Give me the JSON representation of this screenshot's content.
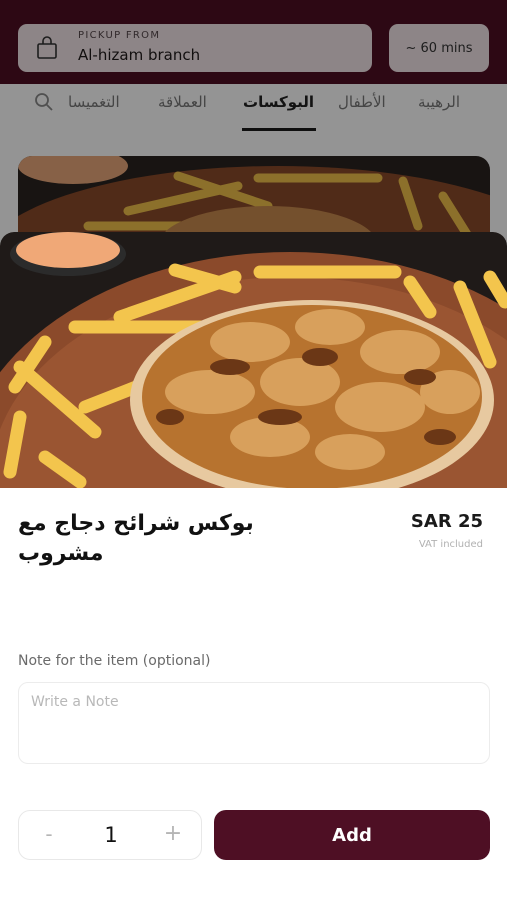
{
  "header": {
    "pickup_label": "PICKUP FROM",
    "branch_name": "Al-hizam branch",
    "eta": "~ 60 mins",
    "icons": {
      "pickup": "shopping-bag-icon"
    }
  },
  "categories": {
    "tabs": [
      {
        "label": "الرهيبة",
        "active": false
      },
      {
        "label": "الأطفال",
        "active": false
      },
      {
        "label": "البوكسات",
        "active": true
      },
      {
        "label": "العملاقة",
        "active": false
      },
      {
        "label": "التغميسا",
        "active": false
      }
    ],
    "search_icon": "search-icon"
  },
  "item": {
    "title": "بوكس شرائح دجاج مع مشروب",
    "price": "SAR 25",
    "vat_note": "VAT included",
    "image": "chicken-shawarma-box-with-fries-photo"
  },
  "note": {
    "label": "Note for the item (optional)",
    "placeholder": "Write a Note",
    "value": ""
  },
  "quantity": {
    "minus_label": "-",
    "value": "1",
    "plus_label": "+"
  },
  "actions": {
    "add_label": "Add"
  },
  "colors": {
    "brand": "#4e0f24",
    "pickup_box": "#f3e6e9",
    "overlay": "rgba(0,0,0,0.42)"
  }
}
